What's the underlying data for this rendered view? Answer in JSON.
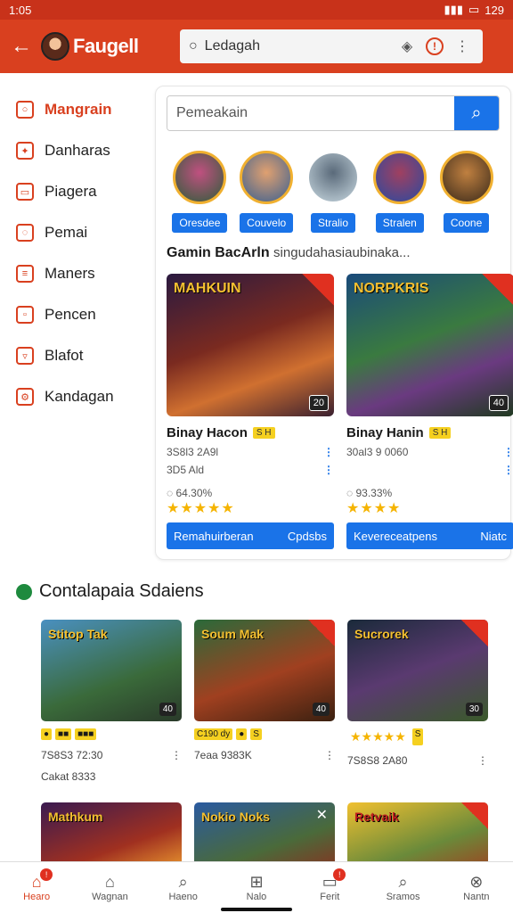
{
  "status": {
    "time": "1:05",
    "battery": "129"
  },
  "header": {
    "brand": "Faugell",
    "search_value": "Ledagah"
  },
  "sidebar": {
    "items": [
      {
        "label": "Mangrain",
        "icon": "search-icon"
      },
      {
        "label": "Danharas",
        "icon": "star-icon"
      },
      {
        "label": "Piagera",
        "icon": "folder-icon"
      },
      {
        "label": "Pemai",
        "icon": "chat-icon"
      },
      {
        "label": "Maners",
        "icon": "document-icon"
      },
      {
        "label": "Pencen",
        "icon": "window-icon"
      },
      {
        "label": "Blafot",
        "icon": "message-icon"
      },
      {
        "label": "Kandagan",
        "icon": "gear-icon"
      }
    ]
  },
  "panel": {
    "search_value": "Pemeakain",
    "categories": [
      "Oresdee",
      "Couvelo",
      "Stralio",
      "Stralen",
      "Coone"
    ],
    "section_title": "Gamin BacArln",
    "section_subtitle": "singudahasiaubinaka...",
    "cards": [
      {
        "logo": "MAHKUIN",
        "badge": "20",
        "name": "Binay Hacon",
        "tag": "S H",
        "meta1": "3S8l3 2A9l",
        "meta2": "3D5 Ald",
        "rating": "64.30%",
        "btn_left": "Remahuirberan",
        "btn_right": "Cpdsbs"
      },
      {
        "logo": "NORPKRIS",
        "badge": "40",
        "name": "Binay Hanin",
        "tag": "S H",
        "meta1": "30al3 9 0060",
        "meta2": "",
        "rating": "93.33%",
        "btn_left": "Kevereceatpens",
        "btn_right": "Niatc"
      }
    ]
  },
  "recs": {
    "title": "Contalapaia Sdaiens",
    "row1": [
      {
        "logo": "Stitop Tak",
        "badge": "40",
        "tags": [
          "●",
          "■■",
          "■■■"
        ],
        "meta1": "7S8S3 72:30",
        "meta2": "Cakat 8333"
      },
      {
        "logo": "Soum Mak",
        "badge": "40",
        "tags": [
          "C190 dy",
          "●",
          "S"
        ],
        "meta1": "7eaa 9383K",
        "meta2": ""
      },
      {
        "logo": "Sucrorek",
        "badge": "30",
        "tags": [
          "★★★★★",
          "S"
        ],
        "meta1": "7S8S8 2A80",
        "meta2": ""
      }
    ],
    "row2": [
      {
        "logo": "Mathkum"
      },
      {
        "logo": "Nokio Noks"
      },
      {
        "logo": "Retvaik"
      }
    ]
  },
  "bottom_nav": [
    {
      "label": "Hearo",
      "icon": "home-icon",
      "badge": "!"
    },
    {
      "label": "Wagnan",
      "icon": "house-icon",
      "badge": ""
    },
    {
      "label": "Haeno",
      "icon": "search-icon",
      "badge": ""
    },
    {
      "label": "Nalo",
      "icon": "plus-box-icon",
      "badge": ""
    },
    {
      "label": "Ferit",
      "icon": "inbox-icon",
      "badge": "!"
    },
    {
      "label": "Sramos",
      "icon": "search-icon",
      "badge": ""
    },
    {
      "label": "Nantn",
      "icon": "close-circle-icon",
      "badge": ""
    }
  ],
  "colors": {
    "brand": "#d9401f",
    "accent": "#1a73e8",
    "star": "#f5b400"
  }
}
